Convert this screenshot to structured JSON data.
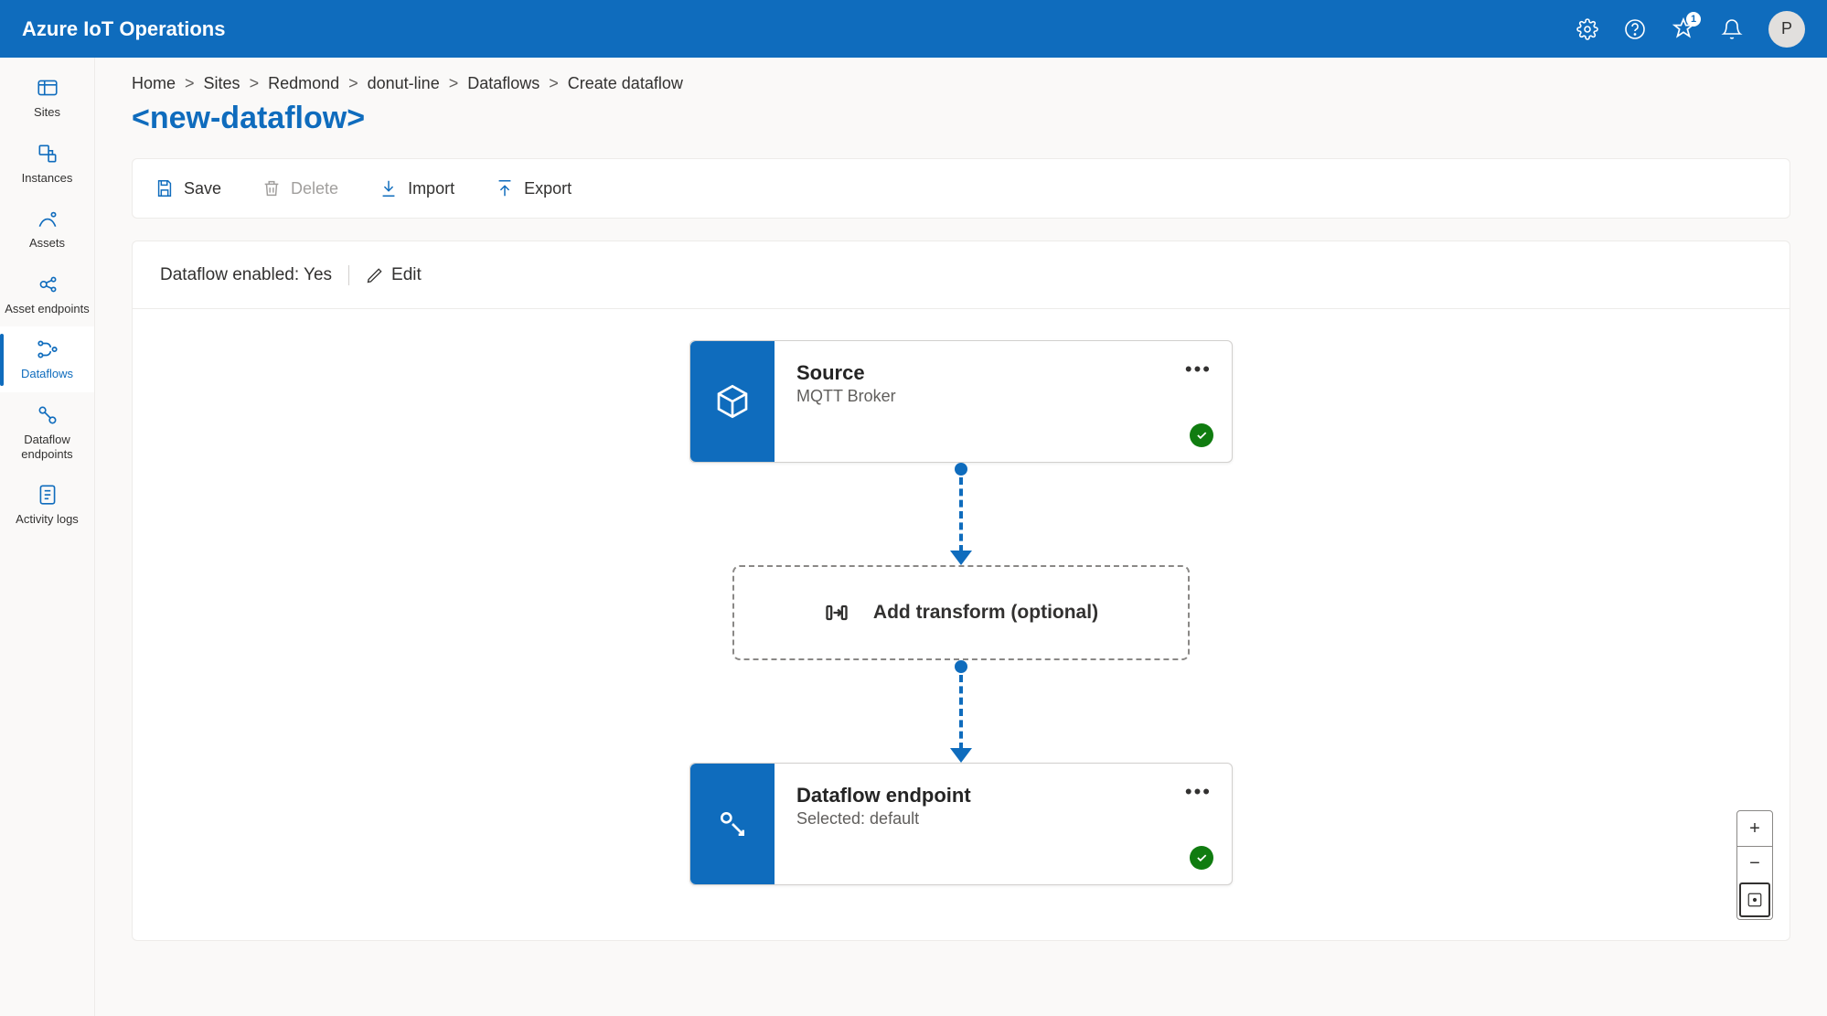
{
  "header": {
    "title": "Azure IoT Operations",
    "notification_count": "1",
    "avatar_initial": "P"
  },
  "sidebar": {
    "items": [
      {
        "label": "Sites"
      },
      {
        "label": "Instances"
      },
      {
        "label": "Assets"
      },
      {
        "label": "Asset endpoints"
      },
      {
        "label": "Dataflows"
      },
      {
        "label": "Dataflow endpoints"
      },
      {
        "label": "Activity logs"
      }
    ]
  },
  "breadcrumb": [
    "Home",
    "Sites",
    "Redmond",
    "donut-line",
    "Dataflows",
    "Create dataflow"
  ],
  "page_title": "<new-dataflow>",
  "toolbar": {
    "save": "Save",
    "delete": "Delete",
    "import": "Import",
    "export": "Export"
  },
  "canvas": {
    "enabled_label": "Dataflow enabled: Yes",
    "edit_label": "Edit",
    "source": {
      "title": "Source",
      "subtitle": "MQTT Broker"
    },
    "transform_label": "Add transform (optional)",
    "endpoint": {
      "title": "Dataflow endpoint",
      "subtitle": "Selected: default"
    }
  },
  "zoom": {
    "in": "+",
    "out": "−"
  }
}
